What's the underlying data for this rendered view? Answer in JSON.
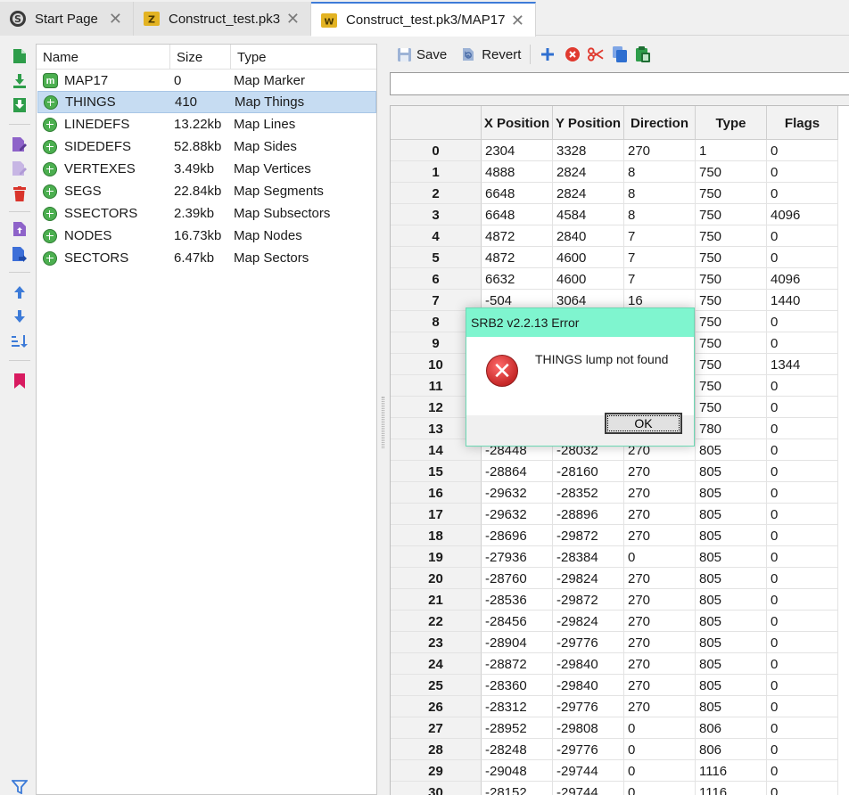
{
  "tabs": [
    {
      "label": "Start Page",
      "icon": "srb2-logo-icon"
    },
    {
      "label": "Construct_test.pk3",
      "icon": "zip-archive-icon"
    },
    {
      "label": "Construct_test.pk3/MAP17",
      "icon": "wad-map-icon",
      "active": true
    }
  ],
  "entry_list": {
    "columns": {
      "name": "Name",
      "size": "Size",
      "type": "Type"
    },
    "rows": [
      {
        "name": "MAP17",
        "size": "0",
        "type": "Map Marker"
      },
      {
        "name": "THINGS",
        "size": "410",
        "type": "Map Things",
        "selected": true
      },
      {
        "name": "LINEDEFS",
        "size": "13.22kb",
        "type": "Map Lines"
      },
      {
        "name": "SIDEDEFS",
        "size": "52.88kb",
        "type": "Map Sides"
      },
      {
        "name": "VERTEXES",
        "size": "3.49kb",
        "type": "Map Vertices"
      },
      {
        "name": "SEGS",
        "size": "22.84kb",
        "type": "Map Segments"
      },
      {
        "name": "SSECTORS",
        "size": "2.39kb",
        "type": "Map Subsectors"
      },
      {
        "name": "NODES",
        "size": "16.73kb",
        "type": "Map Nodes"
      },
      {
        "name": "SECTORS",
        "size": "6.47kb",
        "type": "Map Sectors"
      }
    ]
  },
  "editor_toolbar": {
    "save_label": "Save",
    "revert_label": "Revert"
  },
  "filter": {
    "value": ""
  },
  "things_table": {
    "columns": [
      "X Position",
      "Y Position",
      "Direction",
      "Type",
      "Flags"
    ],
    "rows": [
      [
        "0",
        "2304",
        "3328",
        "270",
        "1",
        "0"
      ],
      [
        "1",
        "4888",
        "2824",
        "8",
        "750",
        "0"
      ],
      [
        "2",
        "6648",
        "2824",
        "8",
        "750",
        "0"
      ],
      [
        "3",
        "6648",
        "4584",
        "8",
        "750",
        "4096"
      ],
      [
        "4",
        "4872",
        "2840",
        "7",
        "750",
        "0"
      ],
      [
        "5",
        "4872",
        "4600",
        "7",
        "750",
        "0"
      ],
      [
        "6",
        "6632",
        "4600",
        "7",
        "750",
        "4096"
      ],
      [
        "7",
        "-504",
        "3064",
        "16",
        "750",
        "1440"
      ],
      [
        "8",
        "",
        "",
        "",
        "750",
        "0"
      ],
      [
        "9",
        "",
        "",
        "",
        "750",
        "0"
      ],
      [
        "10",
        "",
        "",
        "",
        "750",
        "1344"
      ],
      [
        "11",
        "",
        "",
        "",
        "750",
        "0"
      ],
      [
        "12",
        "",
        "",
        "",
        "750",
        "0"
      ],
      [
        "13",
        "",
        "",
        "",
        "780",
        "0"
      ],
      [
        "14",
        "-28448",
        "-28032",
        "270",
        "805",
        "0"
      ],
      [
        "15",
        "-28864",
        "-28160",
        "270",
        "805",
        "0"
      ],
      [
        "16",
        "-29632",
        "-28352",
        "270",
        "805",
        "0"
      ],
      [
        "17",
        "-29632",
        "-28896",
        "270",
        "805",
        "0"
      ],
      [
        "18",
        "-28696",
        "-29872",
        "270",
        "805",
        "0"
      ],
      [
        "19",
        "-27936",
        "-28384",
        "0",
        "805",
        "0"
      ],
      [
        "20",
        "-28760",
        "-29824",
        "270",
        "805",
        "0"
      ],
      [
        "21",
        "-28536",
        "-29872",
        "270",
        "805",
        "0"
      ],
      [
        "22",
        "-28456",
        "-29824",
        "270",
        "805",
        "0"
      ],
      [
        "23",
        "-28904",
        "-29776",
        "270",
        "805",
        "0"
      ],
      [
        "24",
        "-28872",
        "-29840",
        "270",
        "805",
        "0"
      ],
      [
        "25",
        "-28360",
        "-29840",
        "270",
        "805",
        "0"
      ],
      [
        "26",
        "-28312",
        "-29776",
        "270",
        "805",
        "0"
      ],
      [
        "27",
        "-28952",
        "-29808",
        "0",
        "806",
        "0"
      ],
      [
        "28",
        "-28248",
        "-29776",
        "0",
        "806",
        "0"
      ],
      [
        "29",
        "-29048",
        "-29744",
        "0",
        "1116",
        "0"
      ],
      [
        "30",
        "-28152",
        "-29744",
        "0",
        "1116",
        "0"
      ]
    ]
  },
  "dialog": {
    "title": "SRB2 v2.2.13 Error",
    "message": "THINGS lump not found",
    "ok_label": "OK"
  },
  "colors": {
    "accent": "#3d7bd8",
    "dialog_title": "#7ff5cf",
    "selection": "#c6dcf2",
    "error": "#c62828"
  }
}
